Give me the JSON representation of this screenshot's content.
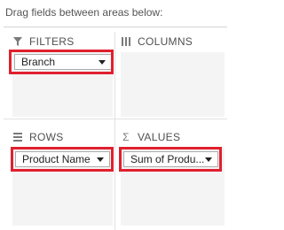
{
  "header": {
    "instruction": "Drag fields between areas below:"
  },
  "areas": {
    "filters": {
      "label": "FILTERS",
      "icon": "funnel-icon",
      "field": "Branch"
    },
    "columns": {
      "label": "COLUMNS",
      "icon": "columns-icon"
    },
    "rows": {
      "label": "ROWS",
      "icon": "rows-icon",
      "field": "Product Name"
    },
    "values": {
      "label": "VALUES",
      "icon": "sigma-icon",
      "field": "Sum of Produ..."
    }
  },
  "colors": {
    "highlight": "#e0202e",
    "area_bg": "#f4f4f4"
  }
}
